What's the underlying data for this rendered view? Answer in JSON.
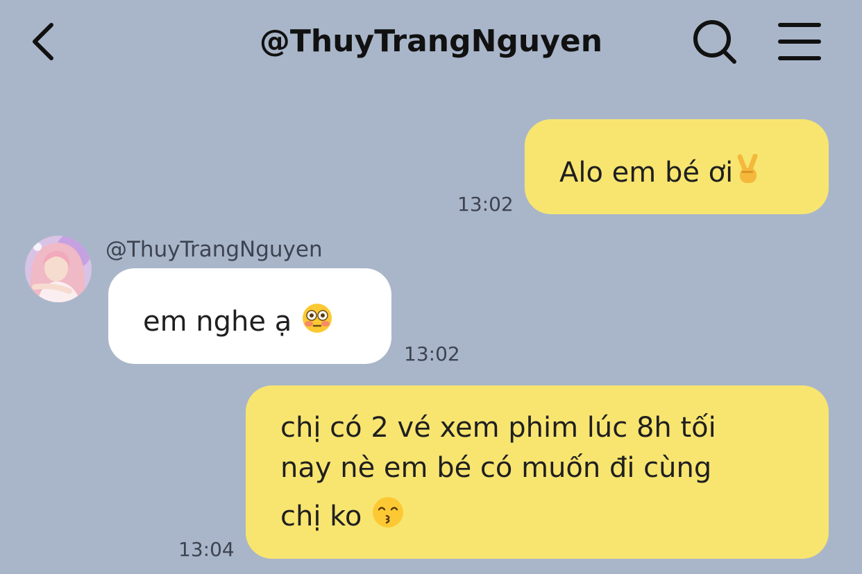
{
  "header": {
    "title": "@ThuyTrangNguyen",
    "back_icon": "chevron-left-icon",
    "search_icon": "search-icon",
    "menu_icon": "hamburger-menu-icon"
  },
  "messages": [
    {
      "direction": "outgoing",
      "text": "Alo em bé ơi",
      "emoji": "victory-hand-emoji",
      "time": "13:02"
    },
    {
      "direction": "incoming",
      "sender": "@ThuyTrangNguyen",
      "text": "em nghe ạ",
      "emoji": "flushed-face-emoji",
      "time": "13:02"
    },
    {
      "direction": "outgoing",
      "lines": [
        "chị có 2 vé xem phim lúc 8h tối",
        "nay nè em bé có muốn đi cùng",
        "chị ko"
      ],
      "emoji": "kissing-face-emoji",
      "time": "13:04"
    }
  ],
  "colors": {
    "background": "#a9b6c9",
    "outgoing_bubble": "#f8e570",
    "incoming_bubble": "#ffffff"
  }
}
